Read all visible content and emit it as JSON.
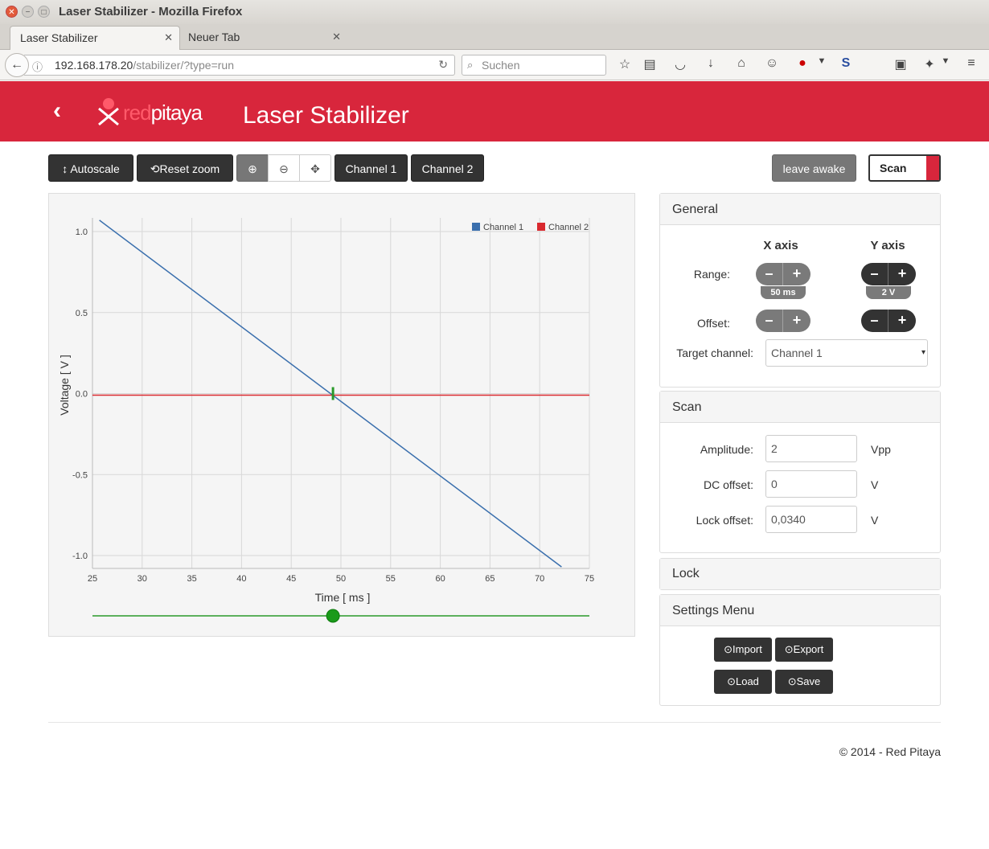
{
  "window": {
    "title": "Laser Stabilizer - Mozilla Firefox"
  },
  "tabs": [
    {
      "label": "Laser Stabilizer",
      "close": "✕"
    },
    {
      "label": "Neuer Tab",
      "close": "✕"
    }
  ],
  "nav": {
    "url_host": "192.168.178.20",
    "url_path": "/stabilizer/?type=run",
    "search_placeholder": "Suchen"
  },
  "header": {
    "title": "Laser Stabilizer",
    "logo_red": "red",
    "logo_white": "pitaya"
  },
  "toolbar": {
    "autoscale": "Autoscale",
    "reset_zoom": "Reset zoom",
    "channel1": "Channel 1",
    "channel2": "Channel 2",
    "leave_awake": "leave awake",
    "scan": "Scan"
  },
  "general": {
    "title": "General",
    "x_axis": "X axis",
    "y_axis": "Y axis",
    "range_label": "Range:",
    "offset_label": "Offset:",
    "x_range_value": "50 ms",
    "y_range_value": "2 V",
    "minus": "–",
    "plus": "+",
    "target_label": "Target channel:",
    "target_value": "Channel 1"
  },
  "scan": {
    "title": "Scan",
    "amplitude_label": "Amplitude:",
    "amplitude_value": "2",
    "amplitude_unit": "Vpp",
    "dc_label": "DC offset:",
    "dc_value": "0",
    "dc_unit": "V",
    "lock_label": "Lock offset:",
    "lock_value": "0,0340",
    "lock_unit": "V"
  },
  "lock": {
    "title": "Lock"
  },
  "settings": {
    "title": "Settings Menu",
    "import": "Import",
    "export": "Export",
    "load": "Load",
    "save": "Save"
  },
  "footer": {
    "text": "© 2014 - Red Pitaya"
  },
  "colors": {
    "brand": "#d8263c",
    "channel1": "#3a6fad",
    "channel2": "#d9292f",
    "cursor": "#2a9a2a"
  },
  "chart_data": {
    "type": "line",
    "xlabel": "Time [ ms ]",
    "ylabel": "Voltage [ V ]",
    "xlim": [
      25,
      75
    ],
    "ylim": [
      -1.05,
      1.1
    ],
    "xticks": [
      25,
      30,
      35,
      40,
      45,
      50,
      55,
      60,
      65,
      70,
      75
    ],
    "yticks": [
      1.0,
      0.5,
      0.0,
      -0.5,
      -1.0
    ],
    "ytick_labels": [
      "1.0",
      "0.5",
      "0.0",
      "-0.5",
      "-1.0"
    ],
    "grid": true,
    "legend_position": "top-right",
    "series": [
      {
        "name": "Channel 1",
        "x": [
          25.7,
          72.2
        ],
        "y": [
          1.07,
          -1.07
        ]
      },
      {
        "name": "Channel 2",
        "x": [
          25,
          75
        ],
        "y": [
          -0.01,
          -0.01
        ]
      }
    ],
    "cursor_x": 49.2,
    "slider_x": 49.2
  }
}
